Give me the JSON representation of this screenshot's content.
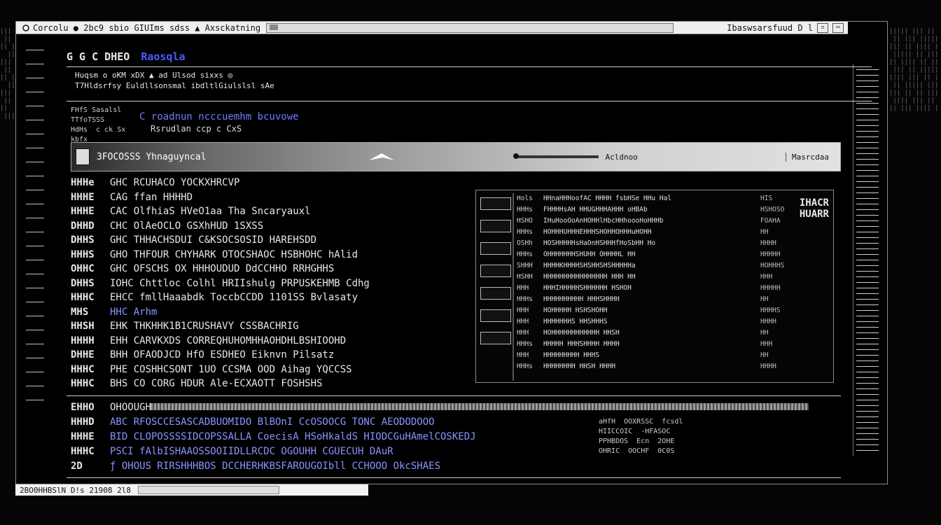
{
  "window": {
    "title": "Corcolu ● 2bc9 sbio GIUIms sdss ▲ Axsckatning",
    "title_right": "Ibaswsarsfuud D l",
    "minimize_glyph": "▫",
    "maximize_glyph": "▭"
  },
  "app_header": {
    "nav": "G G C DHEO",
    "brand": "Raosqla"
  },
  "subheader": {
    "line1": "Huqsm  o oKM  xDX  ▲  ad Ulsod sixxs  ◎",
    "line2": "T7Hldsrfsy  Euldllsonsmal  ibdltlGiulslsl sAe"
  },
  "form": {
    "labels": "FHfS Sasalsl\nTTfoTSSS\nHdHs  c ck Sx\nkbfx",
    "heading": "C roadnun ncccuemhm  bcuvowe",
    "sub": "Rsrudlan ccp  c CxS"
  },
  "toolbar": {
    "field": "3FOCOSSS  Yhnaguyncal",
    "button": "Acldnoo",
    "button2": "Masrcdaa"
  },
  "list": [
    {
      "key": "HHHe",
      "text": "GHC  RCUHACO  YOCKXHRCVP"
    },
    {
      "key": "HHHE",
      "text": "CAG  ffan HHHHD"
    },
    {
      "key": "HHHE",
      "text": "CAC  OlfhiaS HVeO1aa Tha Sncaryauxl"
    },
    {
      "key": "DHHD",
      "text": "CHC  OlAeOCLO GSXhHUD  1SXSS"
    },
    {
      "key": "DHHS",
      "text": "GHC  THHACHSDUI C&KSOCSOSID  HAREHSDD"
    },
    {
      "key": "HHHS",
      "text": "GHO  THFOUR  CHYHARK  OTOCSHAOC  HSBHOHC  hAlid"
    },
    {
      "key": "OHHC",
      "text": "GHC  OFSCHS  OX  HHHOUDUD  DdCCHHO  RRHGHHS"
    },
    {
      "key": "DHHS",
      "text": "IOHC  Chttloc Colhl HRIIshulg PRPUSKEHMB  Cdhg"
    },
    {
      "key": "HHHC",
      "text": "EHCC  fmllHaaabdk  ToccbCCDD  1101SS  Bvlasaty"
    },
    {
      "key": "MHS",
      "text": "HHC  Arhm",
      "sel": true
    },
    {
      "key": "HHSH",
      "text": "EHK  THKHHK1B1CRUSHAVY  CSSBACHRIG"
    },
    {
      "key": "HHHH",
      "text": "EHH  CARVKXDS  CORREQHUHOMHHAOHDHLBSHIOOHD"
    },
    {
      "key": "DHHE",
      "text": "BHH  OFAODJCD  HfO  ESDHEO  Eiknvn  Pilsatz"
    },
    {
      "key": "HHHC",
      "text": "PHE  COSHHCSONT  1UO  CCSMA  OOD  Aihag  YQCCSS"
    },
    {
      "key": "HHHC",
      "text": "BHS  CO  CORG  HDUR Ale-ECXAOTT  FOSHSHS"
    }
  ],
  "detail": {
    "corner": "IHACR\nHUARR",
    "rows": [
      [
        "Hols",
        "HHnaHHHoofAC  HHHH  fsbHSe  HHu  Hal",
        "HIS"
      ],
      [
        "HHHs",
        "FHHHHsAH  HHUGHHHAHHH  oHBAb",
        "HSHOSO"
      ],
      [
        "HSHO",
        "IHuHooOoAnHOHHlHbcHHhoooHoHHHb",
        "FOAHA"
      ],
      [
        "HHHs",
        "HOHHHUHHHEHHHSHOHHOHHHuHOHH",
        "HH"
      ],
      [
        "OSHh",
        "HOSHHHHHsHaOnHSHHHfHoSbHH  Ho",
        "HHHH"
      ],
      [
        "HHHs",
        "OHHHHHHHSHUHH  OHHHHL  HH",
        "HHHHH"
      ],
      [
        "SHHH",
        "HHHHKHHHHSHSHHSHSHHHHHa",
        "HOHHHS"
      ],
      [
        "HSHH",
        "HHHHHHHHHHHHHHHH  HHH  HH",
        "HHH"
      ],
      [
        "HHH",
        "HHHIHHHHHSHHHHHH  HSHOH",
        "HHHHH"
      ],
      [
        "HHHs",
        "HHHHHHHHHH  HHHSHHHH",
        "HH"
      ],
      [
        "HHH",
        "HOHHHHH  HSHSHOHH",
        "HHHHS"
      ],
      [
        "HHH",
        "HHHHHHHS  HHSHHHS",
        "HHHH"
      ],
      [
        "HHH",
        "HOHHHHHHHHHHHH  HHSH",
        "HH"
      ],
      [
        "HHHs",
        "HHHHH  HHHSHHHH  HHHH",
        "HHH"
      ],
      [
        "HHH",
        "HHHHHHHHH  HHHS",
        "HH"
      ],
      [
        "HHHs",
        "HHHHHHHH  HHSH  HHHH",
        "HHHH"
      ]
    ]
  },
  "bottom": {
    "rows": [
      {
        "key": "EHHO",
        "text": "OHOOUGH"
      },
      {
        "key": "HHHD",
        "text": "ABC  RFOSCCESASCADBUOMIDO  BlBOnI CcOSOOCG  TONC  AEODODOOO"
      },
      {
        "key": "HHHE",
        "text": "BID  CLOPOSSSSIDCOPSSALLA  CoecisA  HSoHkaldS  HIODCGuHAmelCOSKEDJ"
      },
      {
        "key": "HHHC",
        "text": "PSCI  fAlbISHAAOSSOOIIDLLRCDC  OGOUHH  CGUECUH  DAuR"
      },
      {
        "key": "2D",
        "text": "ƒ  OHOUS  RIRSHHHBOS  DCCHERHKBSFAROUGOIbll  CCHOOO  OkcSHAES"
      }
    ],
    "side": "aHfH  OOXRSSC  fcsdl\nHIICCOIC  -HFASOC\nPPHBDOS  Ecn  2OHE\nOHRIC  OOCHF  0C0S"
  },
  "statusbar": {
    "text": "2BO0HHBSlN  D!s  21908 2l8"
  }
}
